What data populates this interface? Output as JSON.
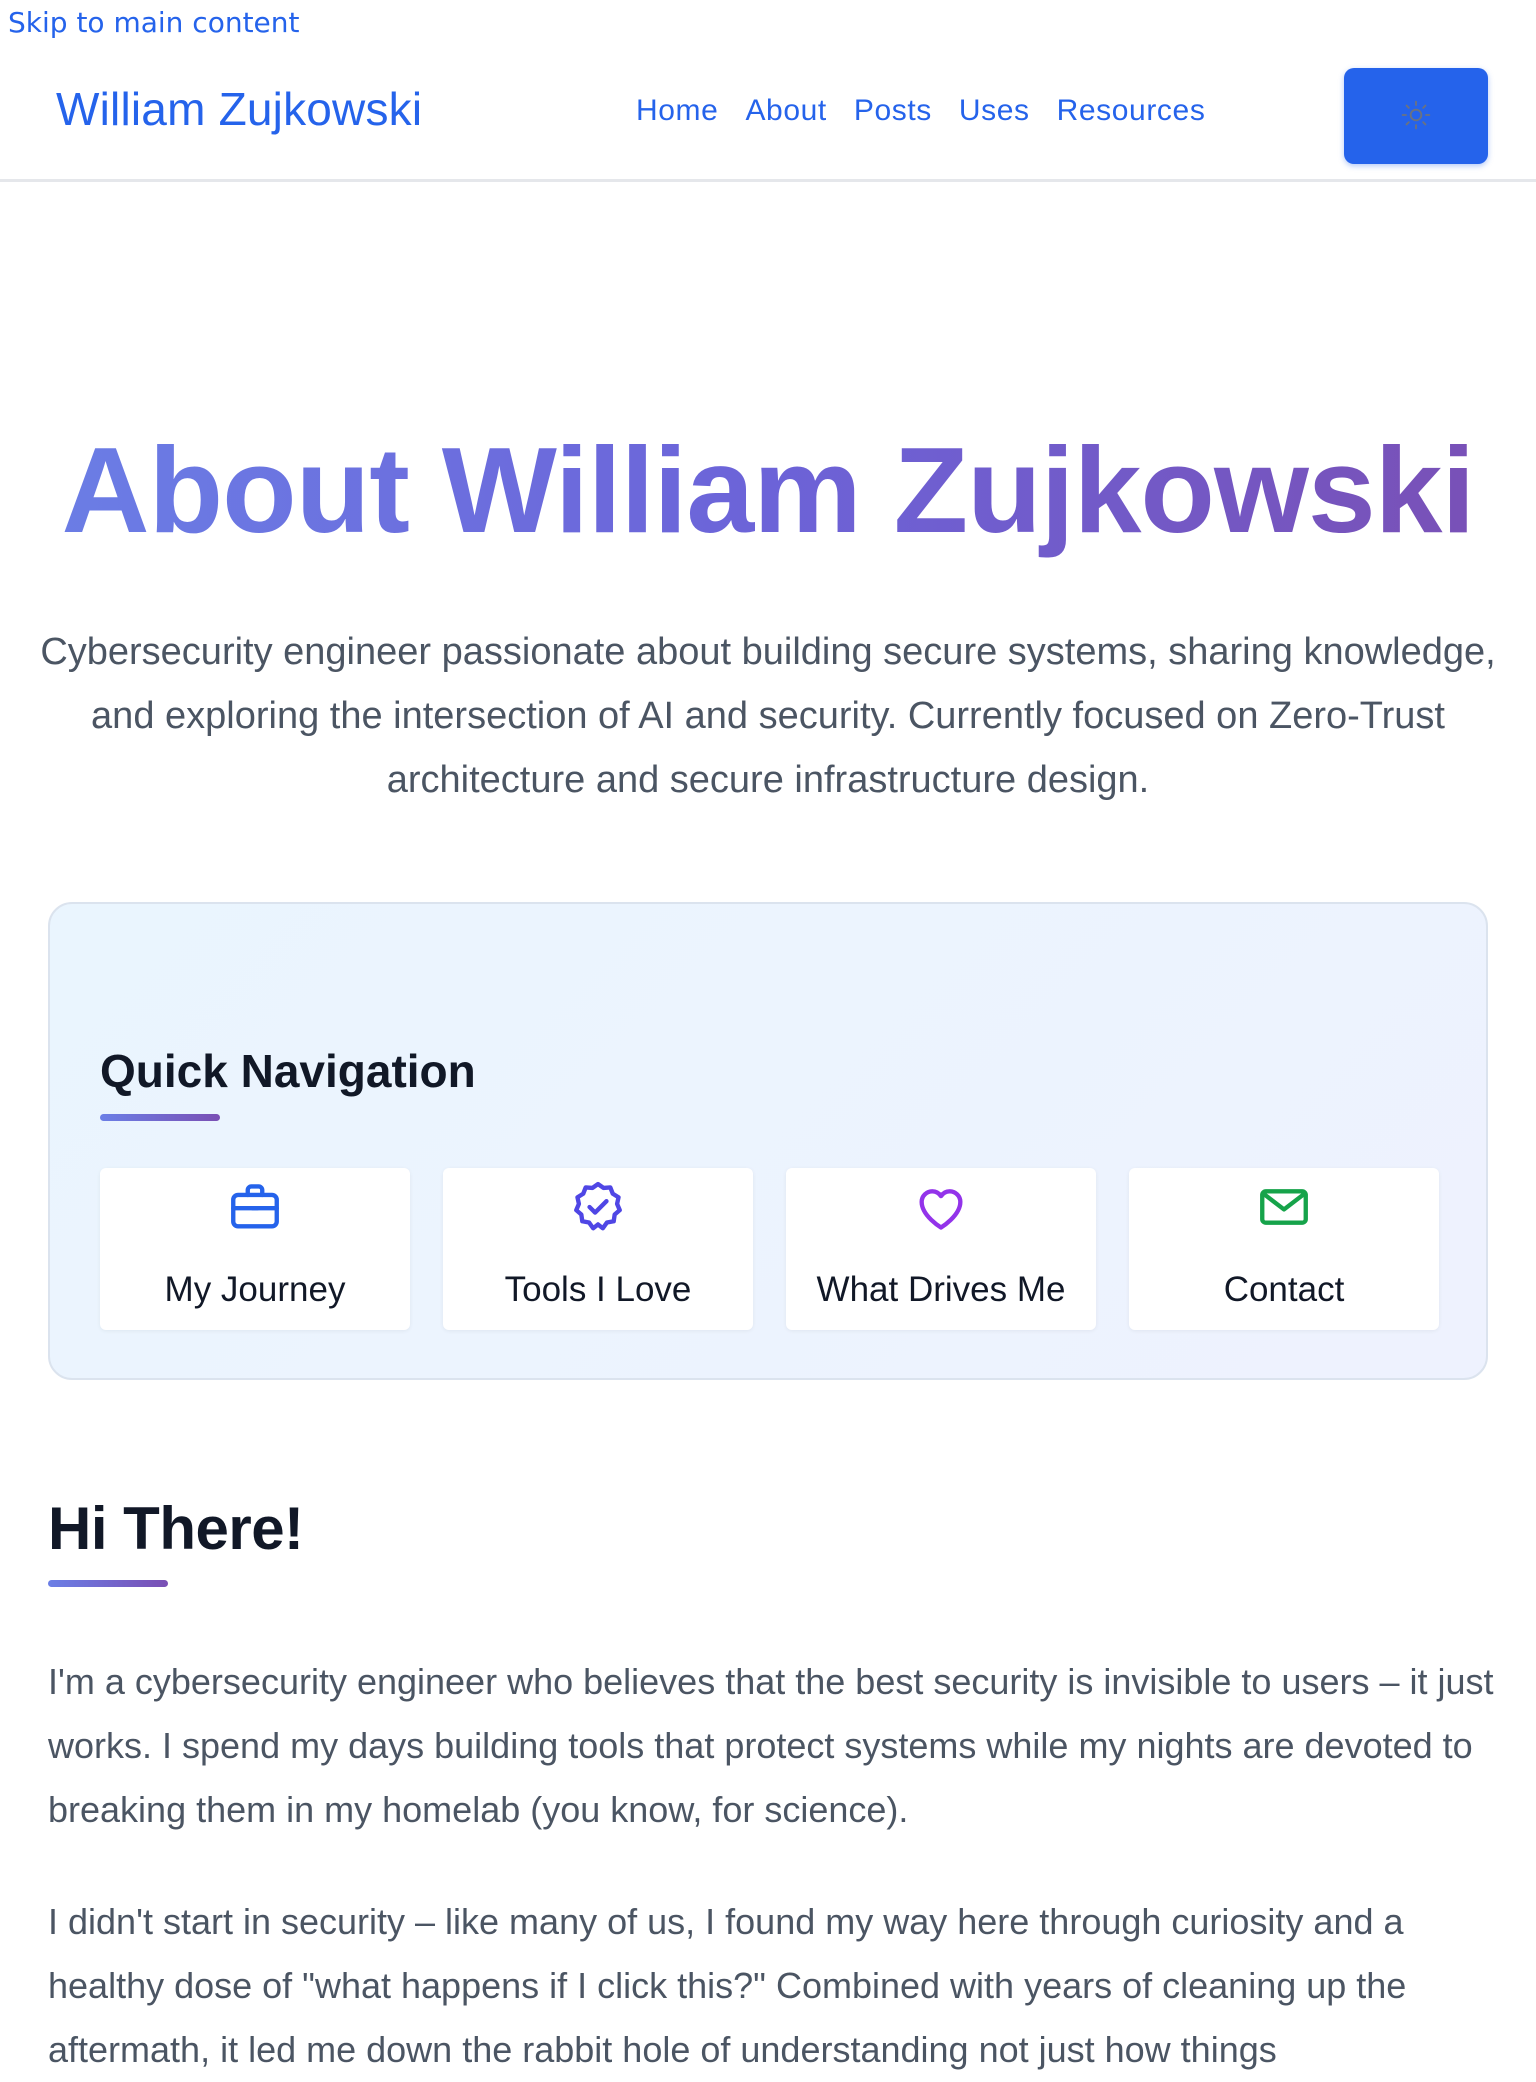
{
  "skip_link": "Skip to main content",
  "header": {
    "brand": "William Zujkowski",
    "nav": [
      "Home",
      "About",
      "Posts",
      "Uses",
      "Resources"
    ],
    "theme_icon": "sun-icon"
  },
  "hero": {
    "title": "About William Zujkowski",
    "subtitle": "Cybersecurity engineer passionate about building secure systems, sharing knowledge, and exploring the intersection of AI and security. Currently focused on Zero-Trust architecture and secure infrastructure design."
  },
  "quick_nav": {
    "title": "Quick Navigation",
    "cards": [
      {
        "label": "My Journey",
        "icon": "briefcase-icon",
        "color": "#2563eb"
      },
      {
        "label": "Tools I Love",
        "icon": "badge-check-icon",
        "color": "#4f46e5"
      },
      {
        "label": "What Drives Me",
        "icon": "heart-icon",
        "color": "#9333ea"
      },
      {
        "label": "Contact",
        "icon": "envelope-icon",
        "color": "#16a34a"
      }
    ]
  },
  "section": {
    "title": "Hi There!",
    "paragraphs": [
      "I'm a cybersecurity engineer who believes that the best security is invisible to users – it just works. I spend my days building tools that protect systems while my nights are devoted to breaking them in my homelab (you know, for science).",
      "I didn't start in security – like many of us, I found my way here through curiosity and a healthy dose of \"what happens if I click this?\" Combined with years of cleaning up the aftermath, it led me down the rabbit hole of understanding not just how things"
    ]
  },
  "colors": {
    "accent": "#2563eb",
    "gradient_start": "#6b7fe6",
    "gradient_end": "#7a4fb4"
  }
}
